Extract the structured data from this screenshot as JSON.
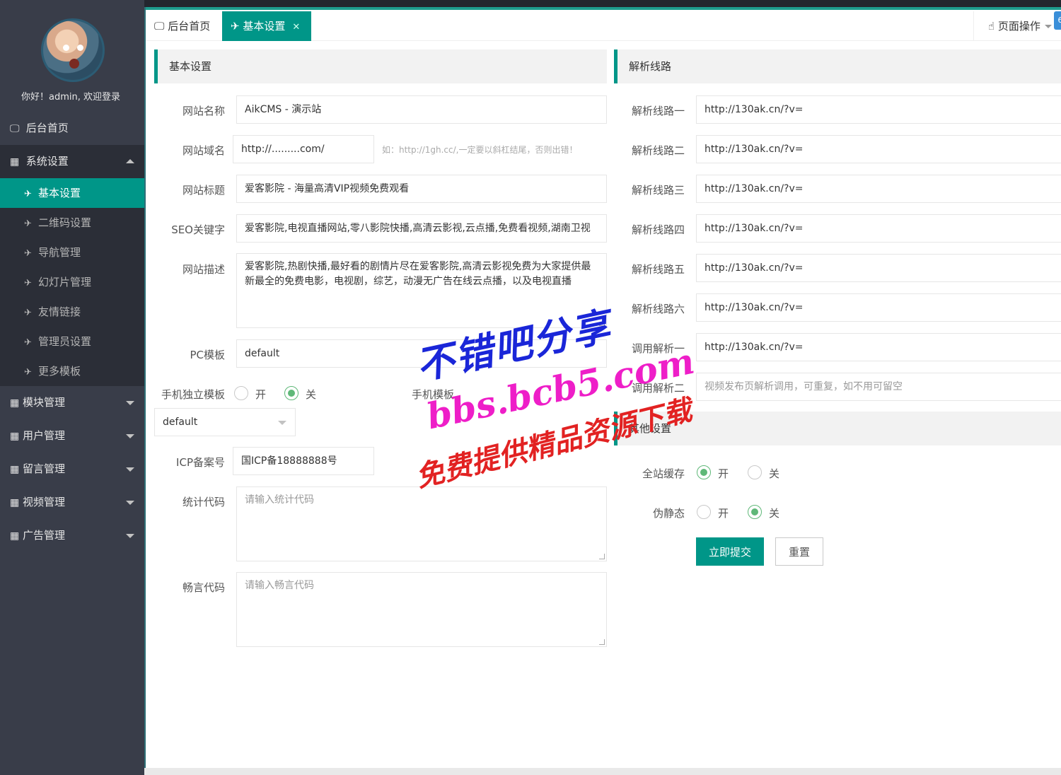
{
  "sidebar": {
    "welcome": "你好！admin, 欢迎登录",
    "home": "后台首页",
    "system": "系统设置",
    "sub": [
      "基本设置",
      "二维码设置",
      "导航管理",
      "幻灯片管理",
      "友情链接",
      "管理员设置",
      "更多模板"
    ],
    "groups": [
      "模块管理",
      "用户管理",
      "留言管理",
      "视频管理",
      "广告管理"
    ]
  },
  "tabs": {
    "home": "后台首页",
    "active": "基本设置",
    "close": "✕",
    "page_ops": "页面操作",
    "badge": "6"
  },
  "basic": {
    "title": "基本设置",
    "site_name_label": "网站名称",
    "site_name": "AikCMS - 演示站",
    "domain_label": "网站域名",
    "domain": "http://.........com/",
    "domain_hint": "如：http://1gh.cc/,一定要以斜杠结尾，否则出错！",
    "site_title_label": "网站标题",
    "site_title": "爱客影院 - 海量高清VIP视频免费观看",
    "seo_label": "SEO关键字",
    "seo": "爱客影院,电视直播网站,零八影院快播,高清云影视,云点播,免费看视频,湖南卫视",
    "desc_label": "网站描述",
    "desc": "爱客影院,热剧快播,最好看的剧情片尽在爱客影院,高清云影视免费为大家提供最新最全的免费电影，电视剧，综艺，动漫无广告在线云点播，以及电视直播",
    "pc_tpl_label": "PC模板",
    "pc_tpl": "default",
    "mobile_tpl_switch_label": "手机独立模板",
    "on": "开",
    "off": "关",
    "mobile_tpl_label": "手机模板",
    "mobile_tpl": "default",
    "icp_label": "ICP备案号",
    "icp": "国ICP备18888888号",
    "stat_label": "统计代码",
    "stat_ph": "请输入统计代码",
    "cy_label": "畅言代码",
    "cy_ph": "请输入畅言代码"
  },
  "lines": {
    "title": "解析线路",
    "items": [
      {
        "label": "解析线路一",
        "value": "http://130ak.cn/?v="
      },
      {
        "label": "解析线路二",
        "value": "http://130ak.cn/?v="
      },
      {
        "label": "解析线路三",
        "value": "http://130ak.cn/?v="
      },
      {
        "label": "解析线路四",
        "value": "http://130ak.cn/?v="
      },
      {
        "label": "解析线路五",
        "value": "http://130ak.cn/?v="
      },
      {
        "label": "解析线路六",
        "value": "http://130ak.cn/?v="
      },
      {
        "label": "调用解析一",
        "value": "http://130ak.cn/?v="
      }
    ],
    "call2_label": "调用解析二",
    "call2_ph": "视频发布页解析调用，可重复，如不用可留空"
  },
  "other": {
    "title": "其他设置",
    "cache_label": "全站缓存",
    "static_label": "伪静态",
    "on": "开",
    "off": "关",
    "submit": "立即提交",
    "reset": "重置"
  },
  "watermark": {
    "line1": "不错吧分享",
    "line2": "bbs.bcb5.com",
    "line3": "免费提供精品资源下载"
  }
}
